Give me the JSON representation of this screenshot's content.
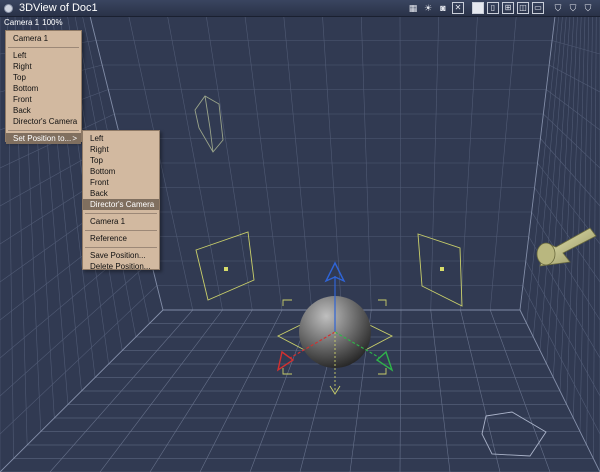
{
  "window": {
    "title": "3DView of Doc1"
  },
  "toolbar": {
    "icons": [
      "grid-icon",
      "light-icon",
      "camera-icon",
      "center-icon",
      "view-single-icon",
      "view-double-icon",
      "view-quad-icon",
      "view-triple-icon",
      "view-split-icon",
      "shield-a-icon",
      "shield-b-icon",
      "shield-c-icon"
    ]
  },
  "viewport": {
    "camera_name": "Camera 1",
    "zoom": "100%"
  },
  "camera_menu": {
    "header": "Camera 1",
    "items": [
      "Left",
      "Right",
      "Top",
      "Bottom",
      "Front",
      "Back",
      "Director's Camera"
    ],
    "set_position_label": "Set Position to...",
    "submenu_arrow": ">"
  },
  "position_submenu": {
    "items": [
      "Left",
      "Right",
      "Top",
      "Bottom",
      "Front",
      "Back",
      "Director's Camera"
    ],
    "highlighted": "Director's Camera",
    "camera_item": "Camera 1",
    "reference_item": "Reference",
    "save_item": "Save Position...",
    "delete_item": "Delete Position..."
  },
  "colors": {
    "background": "#313a52",
    "grid": "#6a7591",
    "menu": "#d2b9a0",
    "menu_highlight": "#806f5f",
    "light_outline": "#c9cf6a",
    "axis_x": "#d23030",
    "axis_y": "#2f64d6",
    "axis_z": "#2fb34a"
  }
}
